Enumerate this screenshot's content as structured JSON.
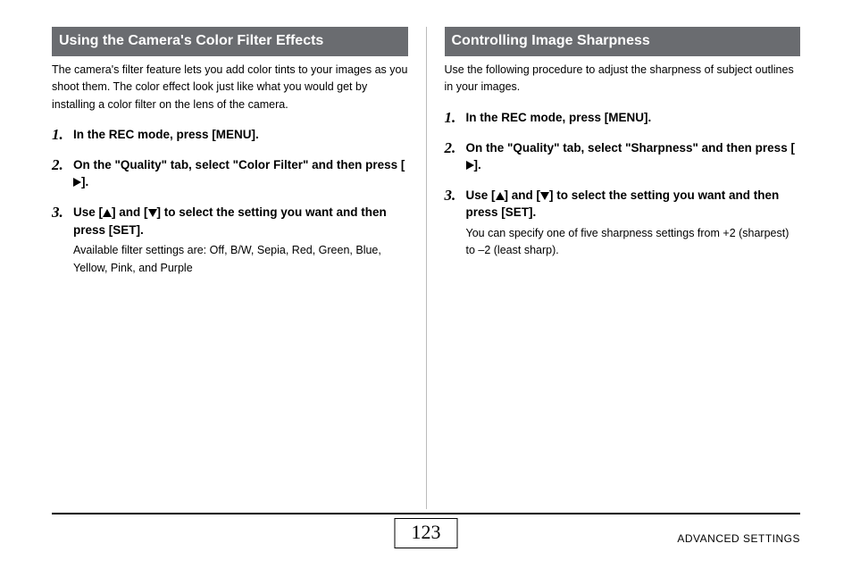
{
  "page_number": "123",
  "footer_label": "ADVANCED SETTINGS",
  "left": {
    "heading": "Using the Camera's Color Filter Effects",
    "intro": "The camera's filter feature lets you add color tints to your images as you shoot them. The color effect look just like what you would get by installing a color filter on the lens of the camera.",
    "steps": [
      {
        "num": "1.",
        "text": "In the REC mode, press [MENU]."
      },
      {
        "num": "2.",
        "pre": "On the \"Quality\" tab, select \"Color Filter\" and then press [",
        "post": "].",
        "icon": "right"
      },
      {
        "num": "3.",
        "pre": "Use [",
        "mid": "] and [",
        "post": "] to select the setting you want and then press [SET].",
        "icon1": "up",
        "icon2": "down",
        "note": "Available filter settings are: Off, B/W, Sepia, Red, Green, Blue, Yellow, Pink, and Purple"
      }
    ]
  },
  "right": {
    "heading": "Controlling Image Sharpness",
    "intro": "Use the following procedure to adjust the sharpness of subject outlines in your images.",
    "steps": [
      {
        "num": "1.",
        "text": "In the REC mode, press [MENU]."
      },
      {
        "num": "2.",
        "pre": "On the \"Quality\" tab, select \"Sharpness\" and then press [",
        "post": "].",
        "icon": "right"
      },
      {
        "num": "3.",
        "pre": "Use [",
        "mid": "] and [",
        "post": "] to select the setting you want and then press [SET].",
        "icon1": "up",
        "icon2": "down",
        "note": "You can specify one of five sharpness settings from +2 (sharpest) to –2 (least sharp)."
      }
    ]
  }
}
